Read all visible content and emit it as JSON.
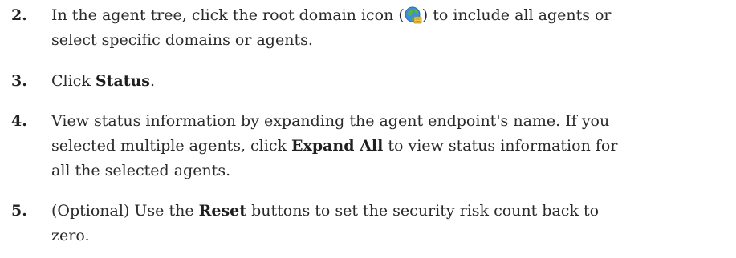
{
  "steps": [
    {
      "number": "2.",
      "text_before_icon": "In the agent tree, click the root domain icon (",
      "icon": "root-domain-globe-icon",
      "text_after_icon": ") to include all agents or",
      "line2": "select specific domains or agents."
    },
    {
      "number": "3.",
      "pre": "Click ",
      "bold": "Status",
      "post": "."
    },
    {
      "number": "4.",
      "line1": "View status information by expanding the agent endpoint's name. If you",
      "line2_pre": "selected multiple agents, click ",
      "line2_bold": "Expand All",
      "line2_post": " to view status information for",
      "line3": "all the selected agents."
    },
    {
      "number": "5.",
      "line1_pre": "(Optional) Use the ",
      "line1_bold": "Reset",
      "line1_post": " buttons to set the security risk count back to",
      "line2": "zero."
    }
  ]
}
